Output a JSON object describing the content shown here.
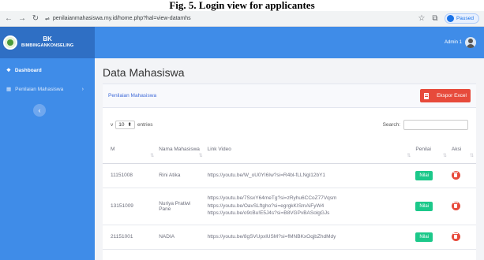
{
  "caption": "Fig. 5. Login view for applicantes",
  "browser": {
    "url": "penilaianmahasiswa.my.id/home.php?hal=view-datamhs",
    "paused_label": "Paused"
  },
  "brand": {
    "line1": "BK",
    "line2": "BIMBINGANKONSELING"
  },
  "sidebar": {
    "items": [
      {
        "label": "Dashboard",
        "icon": "tachometer-icon"
      },
      {
        "label": "Penilaian Mahasiswa",
        "icon": "table-icon"
      }
    ],
    "chevron": "›",
    "collapse_glyph": "‹"
  },
  "topbar": {
    "user_name": "Admin 1"
  },
  "page": {
    "title": "Data Mahasiswa"
  },
  "card": {
    "title": "Penilaian Mahasiswa",
    "export_label": "Ekspor Excel"
  },
  "controls": {
    "show_prefix": "v",
    "length_value": "10",
    "entries_label": "entries",
    "search_label": "Search:"
  },
  "table": {
    "headers": [
      "M",
      "Nama Mahasiswa",
      "Link Video",
      "Penilai",
      "Aksi"
    ],
    "rows": [
      {
        "nim": "11151008",
        "nama": "Rini Atika",
        "links": [
          "https://youtu.be/W_oU0YI6Iw?si=R4bl-fLLNgl12bY1"
        ],
        "nilai_label": "Nilai"
      },
      {
        "nim": "13151009",
        "nama": "Nuriya Pratiwi Pane",
        "links": [
          "https://youtu.be/7SsxY64meTg?si=zRyhu6CCoZ77Vqsm",
          "https://youtu.be/OavSLftgho?si=egrgkKISmAiFyW4",
          "https://youtu.be/o9cBu!E5J4s?si=B8VGPvBASolgGJs"
        ],
        "nilai_label": "Nilai"
      },
      {
        "nim": "21151001",
        "nama": "NADIA",
        "links": [
          "https://youtu.be/8gSVUpxlUSM?si=fMNBKxOqjbZhdMdy"
        ],
        "nilai_label": "Nilai"
      }
    ]
  },
  "colors": {
    "sidebar": "#3f8ce8",
    "brand_bg": "#2f6fc4",
    "export_button": "#e74a3b",
    "nilai_button": "#1cc88a",
    "delete_button": "#e74a3b",
    "card_title": "#3f6ad8"
  }
}
